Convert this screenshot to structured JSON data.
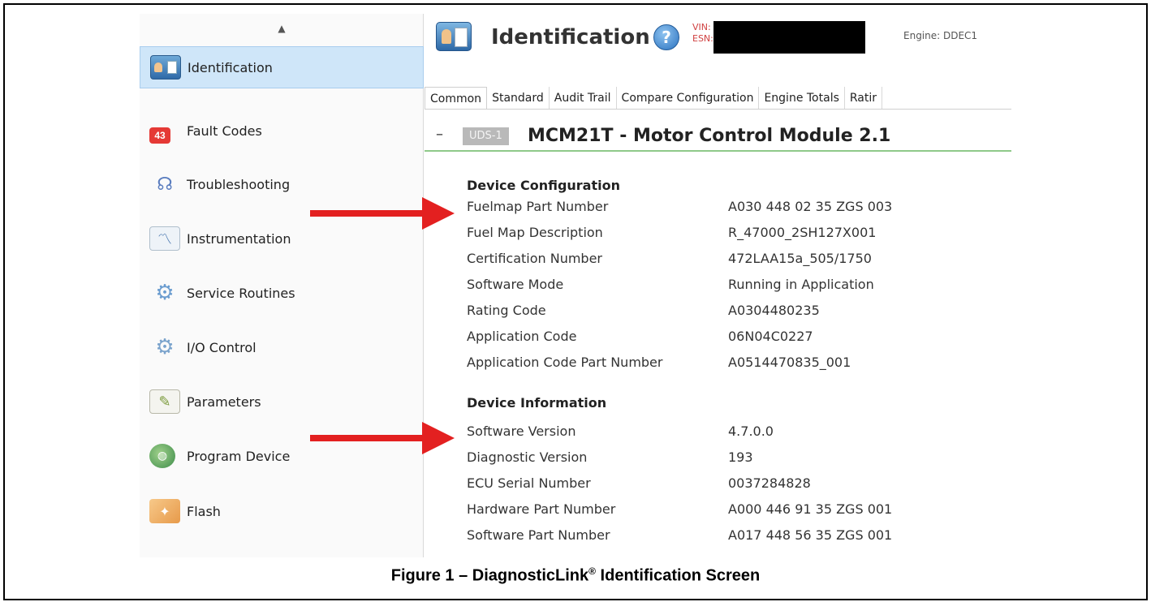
{
  "sidebar": {
    "items": [
      {
        "label": "Identification",
        "icon": "identification-icon",
        "active": true
      },
      {
        "label": "Fault Codes",
        "icon": "fault-codes-icon",
        "badge": "43"
      },
      {
        "label": "Troubleshooting",
        "icon": "stethoscope-icon"
      },
      {
        "label": "Instrumentation",
        "icon": "chart-icon"
      },
      {
        "label": "Service Routines",
        "icon": "gears-icon"
      },
      {
        "label": "I/O Control",
        "icon": "io-gears-icon"
      },
      {
        "label": "Parameters",
        "icon": "notepad-icon"
      },
      {
        "label": "Program Device",
        "icon": "globe-icon"
      },
      {
        "label": "Flash",
        "icon": "flash-icon"
      }
    ]
  },
  "header": {
    "title": "Identification",
    "vin_label": "VIN:",
    "esn_label": "ESN:",
    "engine": "Engine: DDEC1"
  },
  "tabs": [
    "Common",
    "Standard",
    "Audit Trail",
    "Compare Configuration",
    "Engine Totals",
    "Ratir"
  ],
  "module": {
    "collapse": "–",
    "badge": "UDS-1",
    "title": "MCM21T - Motor Control Module 2.1"
  },
  "device_configuration": {
    "heading": "Device Configuration",
    "rows": [
      {
        "label": "Fuelmap Part Number",
        "value": "A030 448 02 35 ZGS 003"
      },
      {
        "label": "Fuel Map Description",
        "value": "R_47000_2SH127X001"
      },
      {
        "label": "Certification Number",
        "value": "472LAA15a_505/1750"
      },
      {
        "label": "Software Mode",
        "value": "Running in Application"
      },
      {
        "label": "Rating Code",
        "value": "A0304480235"
      },
      {
        "label": "Application Code",
        "value": "06N04C0227"
      },
      {
        "label": "Application Code Part Number",
        "value": "A0514470835_001"
      }
    ]
  },
  "device_information": {
    "heading": "Device Information",
    "rows": [
      {
        "label": "Software Version",
        "value": "4.7.0.0"
      },
      {
        "label": "Diagnostic Version",
        "value": "193"
      },
      {
        "label": "ECU Serial Number",
        "value": "0037284828"
      },
      {
        "label": "Hardware Part Number",
        "value": "A000 446 91 35 ZGS 001"
      },
      {
        "label": "Software Part Number",
        "value": "A017 448 56 35 ZGS 001"
      }
    ]
  },
  "caption": {
    "prefix": "Figure 1 – DiagnosticLink",
    "mark": "®",
    "suffix": " Identification Screen"
  },
  "colors": {
    "arrow": "#e32020",
    "active_nav": "#cfe6f9",
    "module_rule": "#8fc98a"
  }
}
